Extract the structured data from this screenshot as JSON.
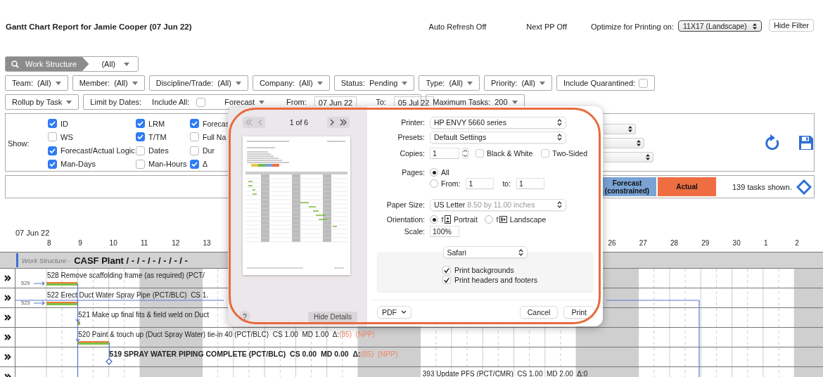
{
  "header": {
    "title": "Gantt Chart Report for Jamie Cooper (07 Jun 22)",
    "auto_refresh": "Auto Refresh Off",
    "next_pp": "Next PP Off",
    "optimize_label": "Optimize for Printing on:",
    "optimize_value": "11X17 (Landscape)",
    "hide_filter": "Hide Filter"
  },
  "work_structure": {
    "label": "Work Structure",
    "value": "(All)"
  },
  "filters": [
    {
      "label": "Team:",
      "value": "(All)"
    },
    {
      "label": "Member:",
      "value": "(All)"
    },
    {
      "label": "Discipline/Trade:",
      "value": "(All)"
    },
    {
      "label": "Company:",
      "value": "(All)"
    },
    {
      "label": "Status:",
      "value": "Pending"
    },
    {
      "label": "Type:",
      "value": "(All)"
    },
    {
      "label": "Priority:",
      "value": "(All)"
    }
  ],
  "include_quarantined": {
    "label": "Include Quarantined:",
    "checked": false
  },
  "rollup": "Rollup by Task",
  "date_limit": {
    "label": "Limit by Dates:",
    "include_all_label": "Include All:",
    "include_all": false,
    "basis": "Forecast",
    "from_label": "From:",
    "from": "07 Jun 22",
    "to_label": "To:",
    "to": "05 Jul 22"
  },
  "max_tasks": {
    "label": "Maximum Tasks:",
    "value": "200"
  },
  "show": {
    "label": "Show:",
    "columns": [
      [
        {
          "label": "ID",
          "checked": true
        },
        {
          "label": "WS",
          "checked": false
        },
        {
          "label": "Forecast/Actual Logic",
          "checked": true
        },
        {
          "label": "Man-Days",
          "checked": true
        }
      ],
      [
        {
          "label": "LRM",
          "checked": true
        },
        {
          "label": "T/TM",
          "checked": true
        },
        {
          "label": "Dates",
          "checked": false
        },
        {
          "label": "Man-Hours",
          "checked": false
        }
      ],
      [
        {
          "label": "Forecas",
          "checked": true
        },
        {
          "label": "Full Na",
          "checked": false
        },
        {
          "label": "Dur",
          "checked": false
        },
        {
          "label": "Δ",
          "checked": true
        }
      ]
    ]
  },
  "legend": [
    {
      "label": "Forecast (constrained)",
      "color": "#7aa3d4"
    },
    {
      "label": "Actual",
      "color": "#ee6e42"
    }
  ],
  "tasks_shown": "139 tasks shown.",
  "gantt": {
    "start_date": "07 Jun 22",
    "days_before": [
      "8",
      "9",
      "10",
      "11",
      "12",
      "13"
    ],
    "days_after": [
      "26",
      "27",
      "28",
      "29",
      "30",
      "1",
      "2"
    ],
    "group": {
      "prefix": "Work Structure -",
      "title": "CASF Plant / - / - / - / - / - / -"
    },
    "tasks": [
      {
        "title": "528 Remove scaffolding frame (as required) (PCT/",
        "bold": false,
        "predecessor": "529",
        "kind": "bar"
      },
      {
        "title": "522 Erect Duct Water Spray Pipe (PCT/BLC)",
        "metrics": "CS 1.",
        "bold": false,
        "predecessor": "523",
        "kind": "bar"
      },
      {
        "title": "521 Make up final fits & field weld on Duct",
        "bold": false,
        "kind": "bar"
      },
      {
        "title": "520 Paint & touch up (Duct Spray Water) tie-in 40 (PCT/BLC)",
        "metrics": "CS 1.00  MD 1.00",
        "delta_label": "Δ:",
        "delta": "(85)",
        "late": true,
        "tag": "(NPP)",
        "bold": false,
        "kind": "bar"
      },
      {
        "title": "519 SPRAY WATER PIPING COMPLETE (PCT/BLC)",
        "metrics": "CS 0.00  MD 0.00",
        "delta_label": "Δ:",
        "delta": "(85)",
        "late": true,
        "tag": "(NPP)",
        "bold": true,
        "kind": "milestone"
      },
      {
        "title": "393 Update PFS (PCT/CMR)",
        "metrics": "CS 1.00  MD 2.00",
        "delta_label": "Δ:",
        "delta": "0",
        "late": false,
        "bold": false,
        "kind": "none"
      }
    ]
  },
  "print_dialog": {
    "page_indicator": "1 of 6",
    "back_disabled": true,
    "forward_disabled": false,
    "help": "?",
    "hide_details": "Hide Details",
    "printer_label": "Printer:",
    "printer": "HP ENVY 5660 series",
    "presets_label": "Presets:",
    "presets": "Default Settings",
    "copies_label": "Copies:",
    "copies": "1",
    "black_white": {
      "label": "Black & White",
      "checked": false
    },
    "two_sided": {
      "label": "Two-Sided",
      "checked": false
    },
    "pages_label": "Pages:",
    "pages": [
      {
        "label": "All",
        "selected": true
      },
      {
        "label": "From:",
        "selected": false
      }
    ],
    "from": "1",
    "to_label": "to:",
    "to": "1",
    "paper_label": "Paper Size:",
    "paper": "US Letter",
    "paper_detail": "8.50 by 11.00 inches",
    "orientation_label": "Orientation:",
    "orientations": [
      {
        "label": "Portrait",
        "selected": true
      },
      {
        "label": "Landscape",
        "selected": false
      }
    ],
    "scale_label": "Scale:",
    "scale": "100%",
    "app": "Safari",
    "options": [
      {
        "label": "Print backgrounds",
        "checked": true
      },
      {
        "label": "Print headers and footers",
        "checked": true
      }
    ],
    "pdf": "PDF",
    "cancel": "Cancel",
    "print": "Print"
  }
}
